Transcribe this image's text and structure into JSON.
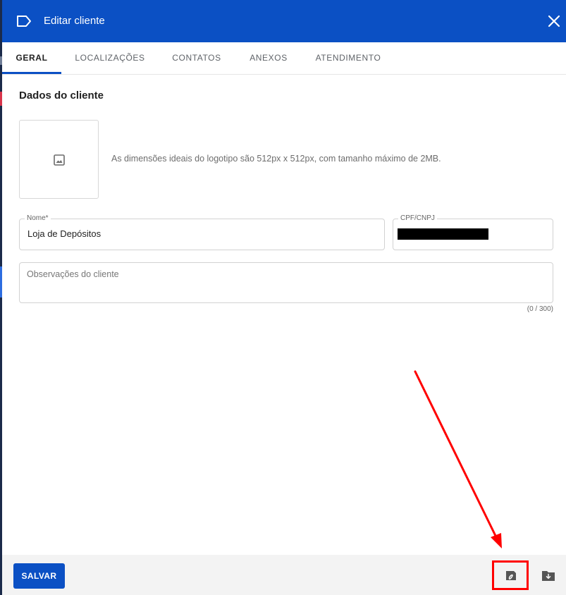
{
  "header": {
    "title": "Editar cliente",
    "label_icon": "label-outline-icon",
    "close_icon": "close-icon",
    "background_color": "#0b50c4"
  },
  "tabs": [
    {
      "label": "GERAL",
      "active": true
    },
    {
      "label": "LOCALIZAÇÕES",
      "active": false
    },
    {
      "label": "CONTATOS",
      "active": false
    },
    {
      "label": "ANEXOS",
      "active": false
    },
    {
      "label": "ATENDIMENTO",
      "active": false
    }
  ],
  "section": {
    "title": "Dados do cliente"
  },
  "logo": {
    "icon": "image-icon",
    "hint": "As dimensões ideais do logotipo são 512px x 512px, com tamanho máximo de 2MB."
  },
  "fields": {
    "nome": {
      "label": "Nome*",
      "value": "Loja de Depósitos"
    },
    "cpf_cnpj": {
      "label": "CPF/CNPJ",
      "value": "",
      "redacted": true
    },
    "observacoes": {
      "placeholder": "Observações do cliente",
      "value": "",
      "counter": "(0 / 300)"
    }
  },
  "footer": {
    "save_label": "SALVAR",
    "icons": [
      "document-edit-icon",
      "folder-download-icon"
    ]
  },
  "annotation": {
    "color": "#ff0000",
    "target": "document-edit-icon"
  }
}
